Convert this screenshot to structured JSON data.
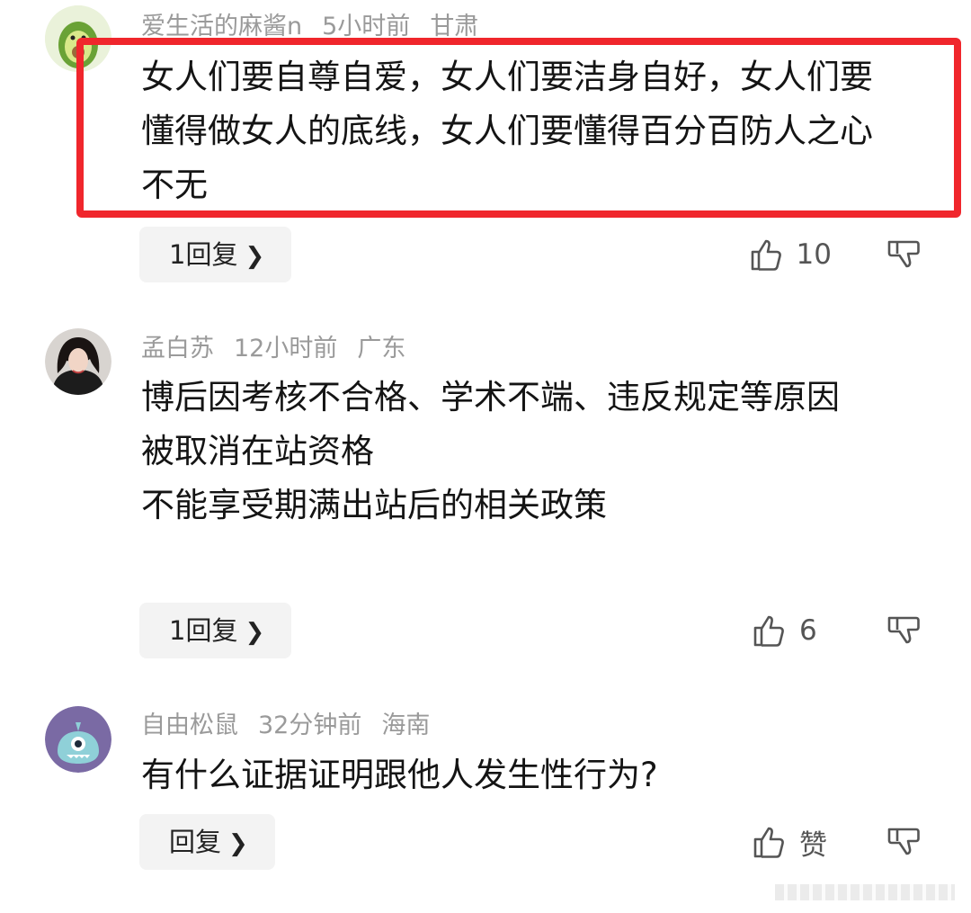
{
  "comments": [
    {
      "username": "爱生活的麻酱n",
      "time": "5小时前",
      "location": "甘肃",
      "text": "女人们要自尊自爱，女人们要洁身自好，女人们要懂得做女人的底线，女人们要懂得百分百防人之心不无",
      "reply_label": "1回复",
      "like_count": "10",
      "highlighted": true,
      "avatar_icon": "avocado-avatar-icon"
    },
    {
      "username": "孟白苏",
      "time": "12小时前",
      "location": "广东",
      "text": "博后因考核不合格、学术不端、违反规定等原因\n被取消在站资格\n不能享受期满出站后的相关政策",
      "reply_label": "1回复",
      "like_count": "6",
      "highlighted": false,
      "avatar_icon": "woman-photo-avatar-icon"
    },
    {
      "username": "自由松鼠",
      "time": "32分钟前",
      "location": "海南",
      "text": "有什么证据证明跟他人发生性行为?",
      "reply_label": "回复",
      "like_count": "赞",
      "highlighted": false,
      "avatar_icon": "monster-avatar-icon"
    }
  ],
  "colors": {
    "highlight_border": "#f0262c",
    "meta_text": "#9a9a9a",
    "reply_bg": "#f3f3f3"
  },
  "icons": {
    "chevron": "chevron-right-icon",
    "like": "thumbs-up-icon",
    "dislike": "thumbs-down-icon"
  }
}
